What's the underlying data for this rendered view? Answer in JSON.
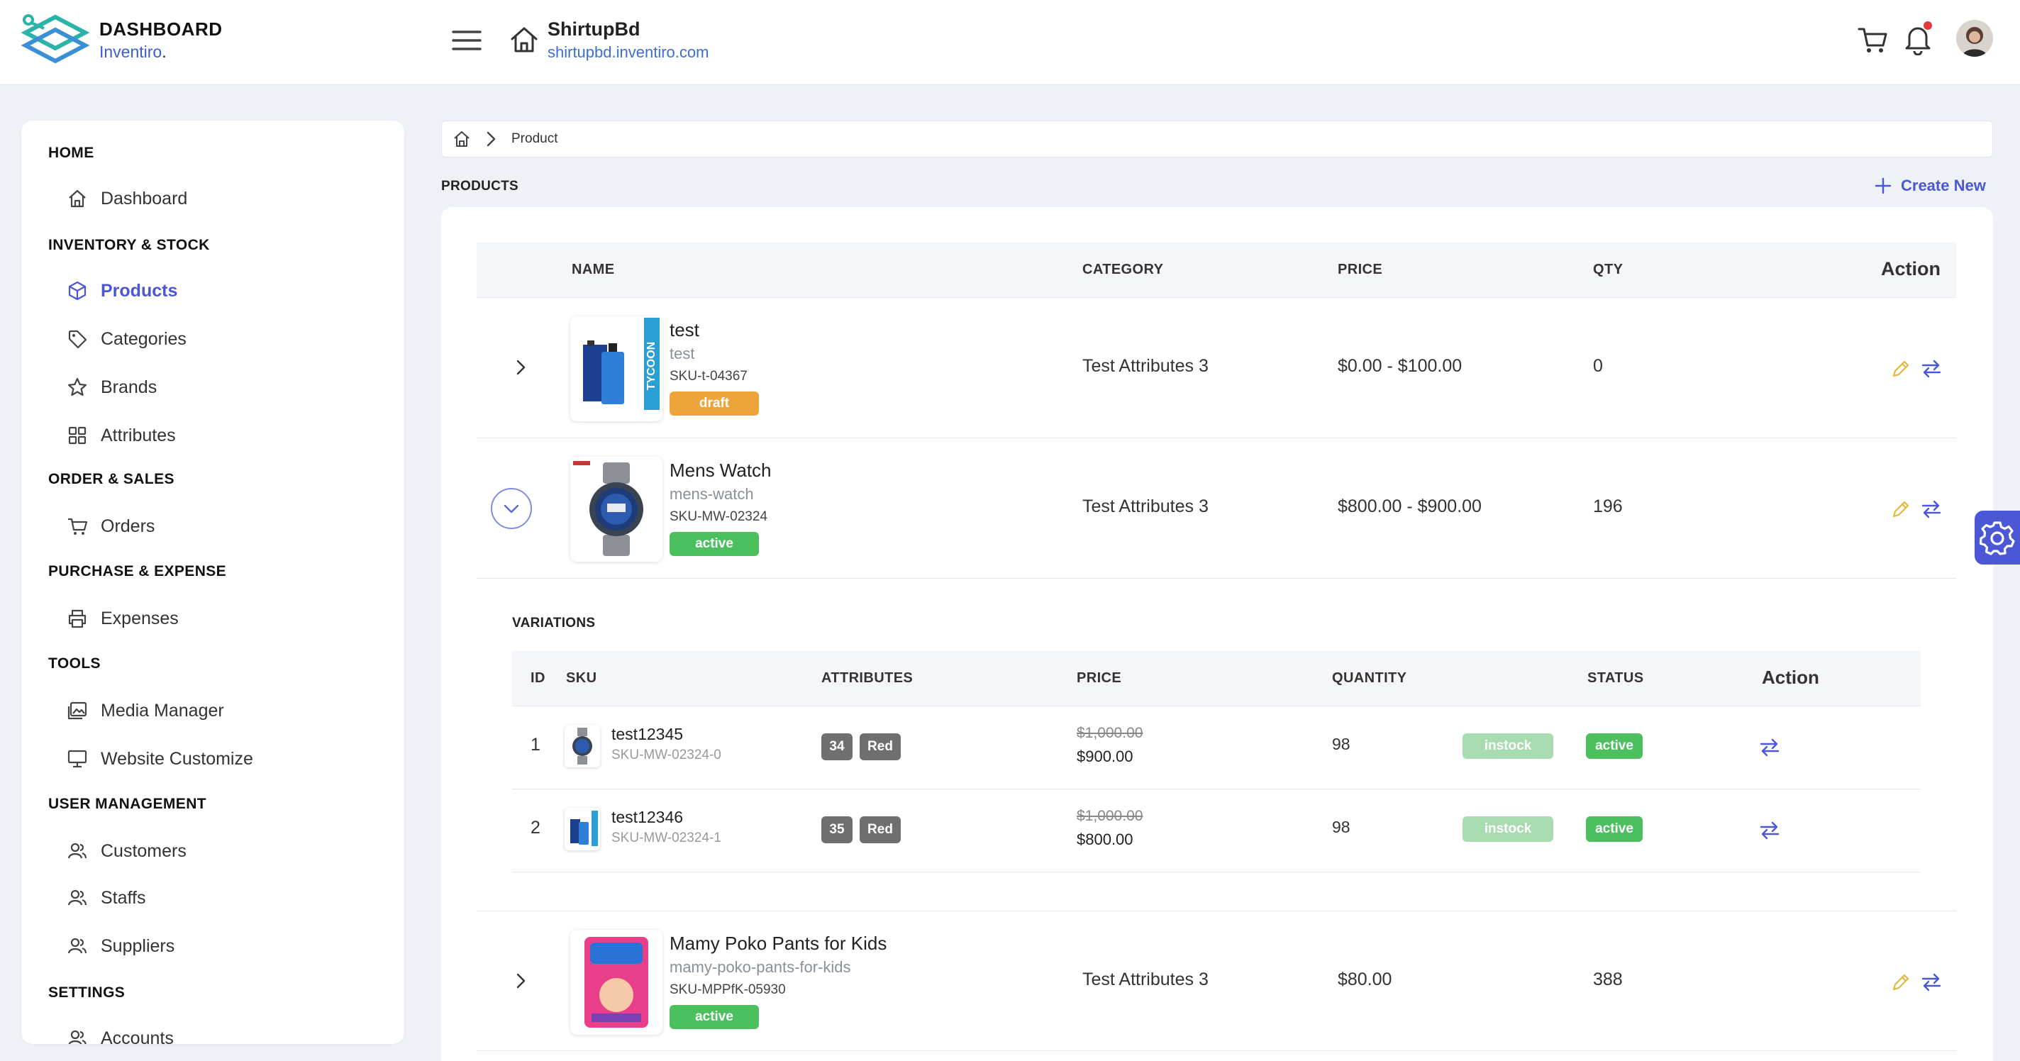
{
  "brand": {
    "title": "DASHBOARD",
    "sub": "Inventiro",
    "sub_dot": "."
  },
  "store": {
    "name": "ShirtupBd",
    "url": "shirtupbd.inventiro.com"
  },
  "sidebar": {
    "sections": [
      "HOME",
      "INVENTORY & STOCK",
      "ORDER & SALES",
      "PURCHASE & EXPENSE",
      "TOOLS",
      "USER MANAGEMENT",
      "SETTINGS"
    ],
    "items": {
      "dashboard": "Dashboard",
      "products": "Products",
      "categories": "Categories",
      "brands": "Brands",
      "attributes": "Attributes",
      "orders": "Orders",
      "expenses": "Expenses",
      "media": "Media Manager",
      "website": "Website Customize",
      "customers": "Customers",
      "staffs": "Staffs",
      "suppliers": "Suppliers",
      "accounts": "Accounts"
    }
  },
  "breadcrumb": {
    "current": "Product"
  },
  "page": {
    "title": "PRODUCTS",
    "create_label": "Create New"
  },
  "table": {
    "headers": {
      "name": "NAME",
      "category": "CATEGORY",
      "price": "PRICE",
      "qty": "QTY",
      "action": "Action"
    },
    "rows": [
      {
        "name": "test",
        "slug": "test",
        "sku": "SKU-t-04367",
        "status": "draft",
        "category": "Test Attributes 3",
        "price": "$0.00 - $100.00",
        "qty": "0"
      },
      {
        "name": "Mens Watch",
        "slug": "mens-watch",
        "sku": "SKU-MW-02324",
        "status": "active",
        "category": "Test Attributes 3",
        "price": "$800.00 - $900.00",
        "qty": "196"
      },
      {
        "name": "Mamy Poko Pants for Kids",
        "slug": "mamy-poko-pants-for-kids",
        "sku": "SKU-MPPfK-05930",
        "status": "active",
        "category": "Test Attributes 3",
        "price": "$80.00",
        "qty": "388"
      }
    ]
  },
  "variations": {
    "title": "VARIATIONS",
    "headers": {
      "id": "ID",
      "sku": "SKU",
      "attributes": "ATTRIBUTES",
      "price": "PRICE",
      "quantity": "QUANTITY",
      "status": "STATUS",
      "action": "Action"
    },
    "rows": [
      {
        "id": "1",
        "sku": "test12345",
        "sku_sub": "SKU-MW-02324-0",
        "attr1": "34",
        "attr2": "Red",
        "old_price": "$1,000.00",
        "price": "$900.00",
        "qty": "98",
        "stock": "instock",
        "status": "active"
      },
      {
        "id": "2",
        "sku": "test12346",
        "sku_sub": "SKU-MW-02324-1",
        "attr1": "35",
        "attr2": "Red",
        "old_price": "$1,000.00",
        "price": "$800.00",
        "qty": "98",
        "stock": "instock",
        "status": "active"
      }
    ]
  },
  "colors": {
    "accent": "#4b57d6",
    "draft": "#eda43a",
    "active": "#4cbf5f",
    "instock": "#a8dbb0"
  },
  "icons": [
    "logo-icon",
    "hamburger-icon",
    "home-icon",
    "cart-icon",
    "bell-icon",
    "box-icon",
    "tag-icon",
    "star-icon",
    "grid-icon",
    "printer-icon",
    "image-icon",
    "monitor-icon",
    "users-icon",
    "plus-icon",
    "chevron-right-icon",
    "chevron-down-icon",
    "pencil-icon",
    "swap-icon",
    "gear-icon"
  ]
}
